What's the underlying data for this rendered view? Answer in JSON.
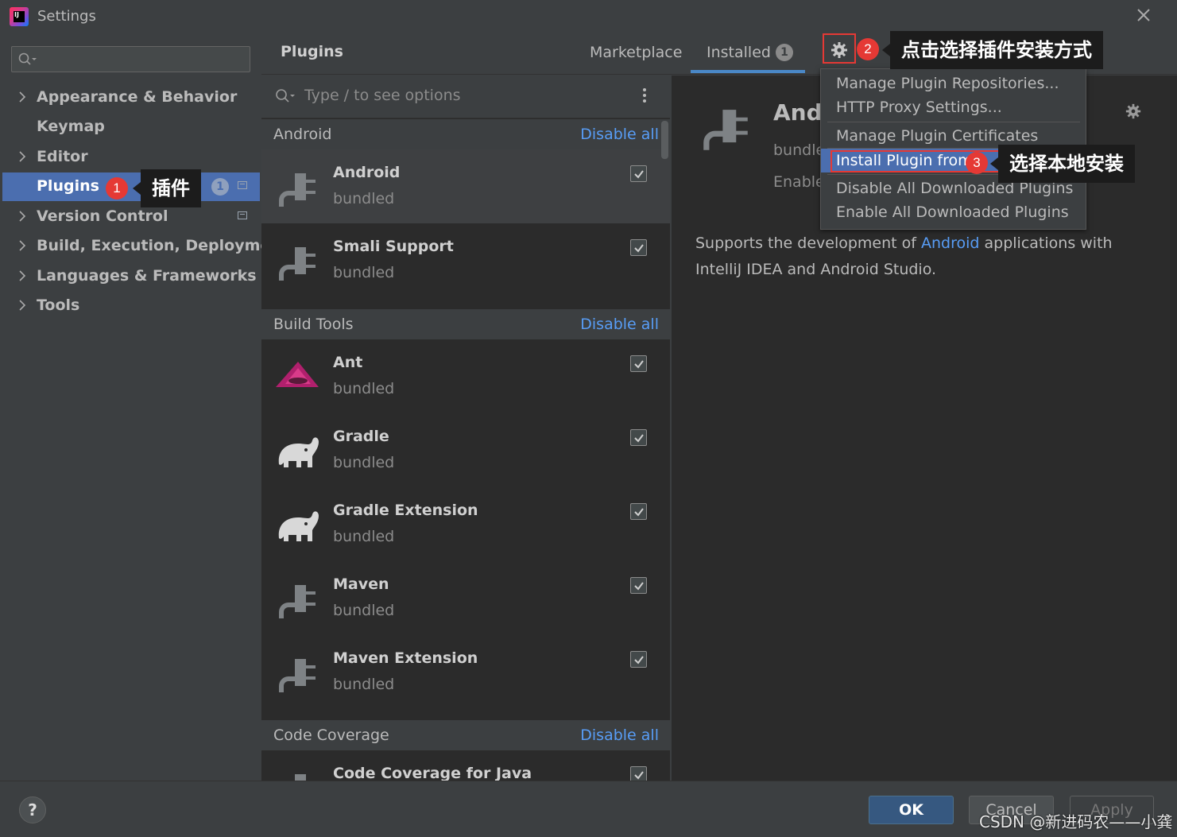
{
  "window": {
    "title": "Settings",
    "app_icon_text": "IJ"
  },
  "sidebar": {
    "search": {
      "placeholder": ""
    },
    "items": [
      {
        "label": "Appearance & Behavior",
        "expandable": true
      },
      {
        "label": "Keymap",
        "expandable": false
      },
      {
        "label": "Editor",
        "expandable": true
      },
      {
        "label": "Plugins",
        "expandable": false,
        "selected": true,
        "badge": "1"
      },
      {
        "label": "Version Control",
        "expandable": true
      },
      {
        "label": "Build, Execution, Deployment",
        "expandable": true
      },
      {
        "label": "Languages & Frameworks",
        "expandable": true
      },
      {
        "label": "Tools",
        "expandable": true
      }
    ]
  },
  "header": {
    "title": "Plugins",
    "tabs": [
      {
        "label": "Marketplace",
        "active": false
      },
      {
        "label": "Installed",
        "active": true,
        "badge": "1"
      }
    ]
  },
  "plugin_list": {
    "search_placeholder": "Type / to see options",
    "groups": [
      {
        "name": "Android",
        "action": "Disable all",
        "plugins": [
          {
            "name": "Android",
            "sub": "bundled",
            "checked": true,
            "icon": "plug-icon"
          },
          {
            "name": "Smali Support",
            "sub": "bundled",
            "checked": true,
            "icon": "plug-icon"
          }
        ]
      },
      {
        "name": "Build Tools",
        "action": "Disable all",
        "plugins": [
          {
            "name": "Ant",
            "sub": "bundled",
            "checked": true,
            "icon": "ant-icon"
          },
          {
            "name": "Gradle",
            "sub": "bundled",
            "checked": true,
            "icon": "elephant-icon"
          },
          {
            "name": "Gradle Extension",
            "sub": "bundled",
            "checked": true,
            "icon": "elephant-icon"
          },
          {
            "name": "Maven",
            "sub": "bundled",
            "checked": true,
            "icon": "plug-icon"
          },
          {
            "name": "Maven Extension",
            "sub": "bundled",
            "checked": true,
            "icon": "plug-icon"
          }
        ]
      },
      {
        "name": "Code Coverage",
        "action": "Disable all",
        "plugins": [
          {
            "name": "Code Coverage for Java",
            "sub": "",
            "checked": true,
            "icon": "plug-icon"
          }
        ]
      }
    ]
  },
  "detail": {
    "name": "Andr",
    "sub": "bundle",
    "enable_label": "Enable",
    "desc_before": "Supports the development of ",
    "desc_link": "Android",
    "desc_after": " applications with IntelliJ IDEA and Android Studio."
  },
  "dropdown": {
    "items": [
      "Manage Plugin Repositories...",
      "HTTP Proxy Settings...",
      "Manage Plugin Certificates",
      "Install Plugin from Disk...",
      "Disable All Downloaded Plugins",
      "Enable All Downloaded Plugins"
    ],
    "highlighted_visible_text": "Install Plugin from "
  },
  "annotations": {
    "step1": {
      "num": "1",
      "text": "插件"
    },
    "step2": {
      "num": "2",
      "text": "点击选择插件安装方式"
    },
    "step3": {
      "num": "3",
      "text": "选择本地安装"
    }
  },
  "footer": {
    "help": "?",
    "ok": "OK",
    "cancel": "Cancel",
    "apply": "Apply",
    "watermark": "CSDN @新进码农——小龚"
  },
  "colors": {
    "accent": "#4b6eaf",
    "link": "#589df6",
    "annotation_red": "#e53935",
    "background": "#3c3f41",
    "panel": "#2b2b2b"
  }
}
